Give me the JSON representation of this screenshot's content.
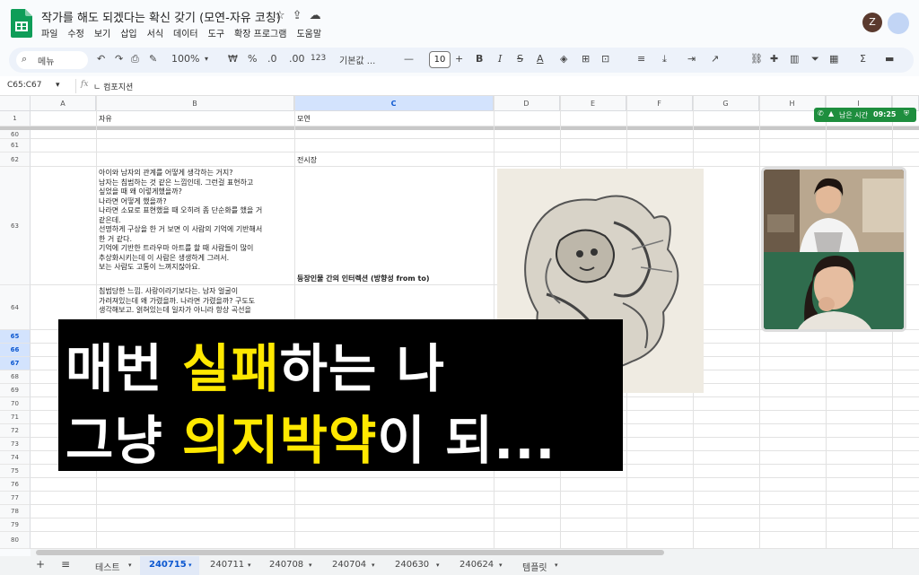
{
  "doc": {
    "title": "작가를 해도 되겠다는 확신 갖기 (모연-자유 코칭)",
    "menu": [
      "파일",
      "수정",
      "보기",
      "삽입",
      "서식",
      "데이터",
      "도구",
      "확장 프로그램",
      "도움말"
    ],
    "avatar_initial": "Z"
  },
  "toolbar": {
    "search_label": "메뉴",
    "zoom": "100%",
    "currency": "₩",
    "percent": "%",
    "dec_decrease": ".0",
    "dec_increase": ".00",
    "number_format": "123",
    "font": "기본값 ...",
    "font_size": "10",
    "minus": "—",
    "plus": "+",
    "bold": "B",
    "italic": "I",
    "text_color": "A"
  },
  "formula_bar": {
    "name_box": "C65:C67",
    "fx": "fx",
    "content": "ㄴ 컴포지션"
  },
  "columns": [
    "A",
    "B",
    "C",
    "D",
    "E",
    "F",
    "G",
    "H",
    "I"
  ],
  "header_row": {
    "num": "1",
    "b": "자유",
    "c": "모연"
  },
  "rows": [
    {
      "num": "60"
    },
    {
      "num": "61"
    },
    {
      "num": "62",
      "c": "전시장"
    },
    {
      "num": "63",
      "b": [
        "아이와 남자의 관계를 어떻게 생각하는 거지?",
        "남자는 침범하는 것 같은 느낌인데. 그런걸 표현하고",
        "싶었을 때 왜 이렇게했을까?",
        "나라면 어떻게 했을까?",
        "나라면 소묘로 표현했을 때 오히려 좀 단순화를 했을 거",
        "같은데.",
        "선명하게 구상을 한 거 보면 이 사람의 기억에 기반해서",
        "한 거 같다.",
        "기억에 기반한 트라우마 아트를 할 때 사람들이 많이",
        "추상화시키는데 이 사람은 생생하게 그려서.",
        "보는 사람도 고통이 느껴지잖아요."
      ],
      "c": "등장인물 간의 인터렉션 (방향성 from to)"
    },
    {
      "num": "64",
      "b": [
        "침범당한 느낌. 사랑이라기보다는. 남자 얼굴이",
        "가려져있는데 왜 가렸을까. 나라면 가렸을까? 구도도",
        "생각해보고. 얽혀있는데 일자가 아니라 항상 곡선을"
      ]
    },
    {
      "num": "65"
    },
    {
      "num": "66"
    },
    {
      "num": "67"
    },
    {
      "num": "68"
    },
    {
      "num": "69"
    },
    {
      "num": "70"
    },
    {
      "num": "71"
    },
    {
      "num": "72"
    },
    {
      "num": "73"
    },
    {
      "num": "74"
    },
    {
      "num": "75"
    },
    {
      "num": "76"
    },
    {
      "num": "77"
    },
    {
      "num": "78"
    },
    {
      "num": "79"
    },
    {
      "num": "80"
    }
  ],
  "call": {
    "label": "남은 시간",
    "time": "09:25"
  },
  "caption": {
    "line1": [
      "매번 ",
      "실패",
      "하는 나"
    ],
    "line2": [
      "그냥 ",
      "의지박약",
      "이 되..."
    ]
  },
  "tabs": [
    "테스트",
    "240715",
    "240711",
    "240708",
    "240704",
    "240630",
    "240624",
    "템플릿"
  ],
  "active_tab": "240715",
  "colors": {
    "accent": "#0b57d0",
    "highlight": "#ffe800",
    "call_green": "#1e8e3e"
  }
}
